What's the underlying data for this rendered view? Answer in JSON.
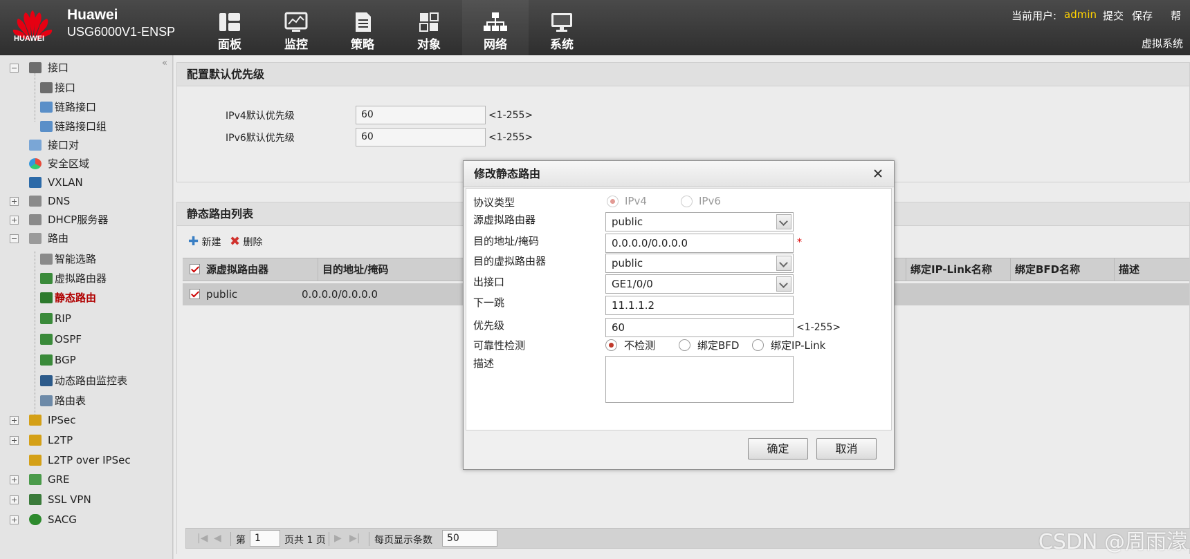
{
  "header": {
    "logo_text": "HUAWEI",
    "brand_name": "Huawei",
    "model": "USG6000V1-ENSP",
    "nav": [
      {
        "label": "面板",
        "icon": "dashboard-icon"
      },
      {
        "label": "监控",
        "icon": "monitor-icon"
      },
      {
        "label": "策略",
        "icon": "policy-icon"
      },
      {
        "label": "对象",
        "icon": "object-icon"
      },
      {
        "label": "网络",
        "icon": "network-icon"
      },
      {
        "label": "系统",
        "icon": "system-icon"
      }
    ],
    "current_user_label": "当前用户:",
    "current_user": "admin",
    "submit": "提交",
    "save": "保存",
    "help": "帮",
    "virtual_system": "虚拟系统"
  },
  "sidebar": {
    "collapse": "«",
    "items": [
      {
        "label": "接口"
      },
      {
        "label": "接口"
      },
      {
        "label": "链路接口"
      },
      {
        "label": "链路接口组"
      },
      {
        "label": "接口对"
      },
      {
        "label": "安全区域"
      },
      {
        "label": "VXLAN"
      },
      {
        "label": "DNS"
      },
      {
        "label": "DHCP服务器"
      },
      {
        "label": "路由"
      },
      {
        "label": "智能选路"
      },
      {
        "label": "虚拟路由器"
      },
      {
        "label": "静态路由"
      },
      {
        "label": "RIP"
      },
      {
        "label": "OSPF"
      },
      {
        "label": "BGP"
      },
      {
        "label": "动态路由监控表"
      },
      {
        "label": "路由表"
      },
      {
        "label": "IPSec"
      },
      {
        "label": "L2TP"
      },
      {
        "label": "L2TP over IPSec"
      },
      {
        "label": "GRE"
      },
      {
        "label": "SSL VPN"
      },
      {
        "label": "SACG"
      }
    ]
  },
  "default_priority": {
    "title": "配置默认优先级",
    "ipv4_label": "IPv4默认优先级",
    "ipv4_value": "60",
    "ipv4_range": "<1-255>",
    "ipv6_label": "IPv6默认优先级",
    "ipv6_value": "60",
    "ipv6_range": "<1-255>"
  },
  "route_list": {
    "title": "静态路由列表",
    "new": "新建",
    "delete": "删除",
    "columns": [
      "源虚拟路由器",
      "目的地址/掩码",
      "绑定IP-Link名称",
      "绑定BFD名称",
      "描述"
    ],
    "rows": [
      {
        "src_vr": "public",
        "dest": "0.0.0.0/0.0.0.0"
      }
    ]
  },
  "pager": {
    "page_prefix": "第",
    "page": "1",
    "page_suffix": "页共 1 页",
    "per_page_label": "每页显示条数",
    "per_page": "50"
  },
  "dialog": {
    "title": "修改静态路由",
    "protocol_label": "协议类型",
    "ipv4": "IPv4",
    "ipv6": "IPv6",
    "src_vr_label": "源虚拟路由器",
    "src_vr_value": "public",
    "dest_label": "目的地址/掩码",
    "dest_value": "0.0.0.0/0.0.0.0",
    "required_mark": "*",
    "dest_vr_label": "目的虚拟路由器",
    "dest_vr_value": "public",
    "out_if_label": "出接口",
    "out_if_value": "GE1/0/0",
    "next_hop_label": "下一跳",
    "next_hop_value": "11.1.1.2",
    "priority_label": "优先级",
    "priority_value": "60",
    "priority_range": "<1-255>",
    "reliability_label": "可靠性检测",
    "no_detect": "不检测",
    "bind_bfd": "绑定BFD",
    "bind_iplink": "绑定IP-Link",
    "desc_label": "描述",
    "ok": "确定",
    "cancel": "取消"
  },
  "watermark": "CSDN @周雨濛",
  "colors": {
    "accent_red": "#c0392b",
    "user_yellow": "#ffd200",
    "header_bg": "#3a3a3a"
  }
}
